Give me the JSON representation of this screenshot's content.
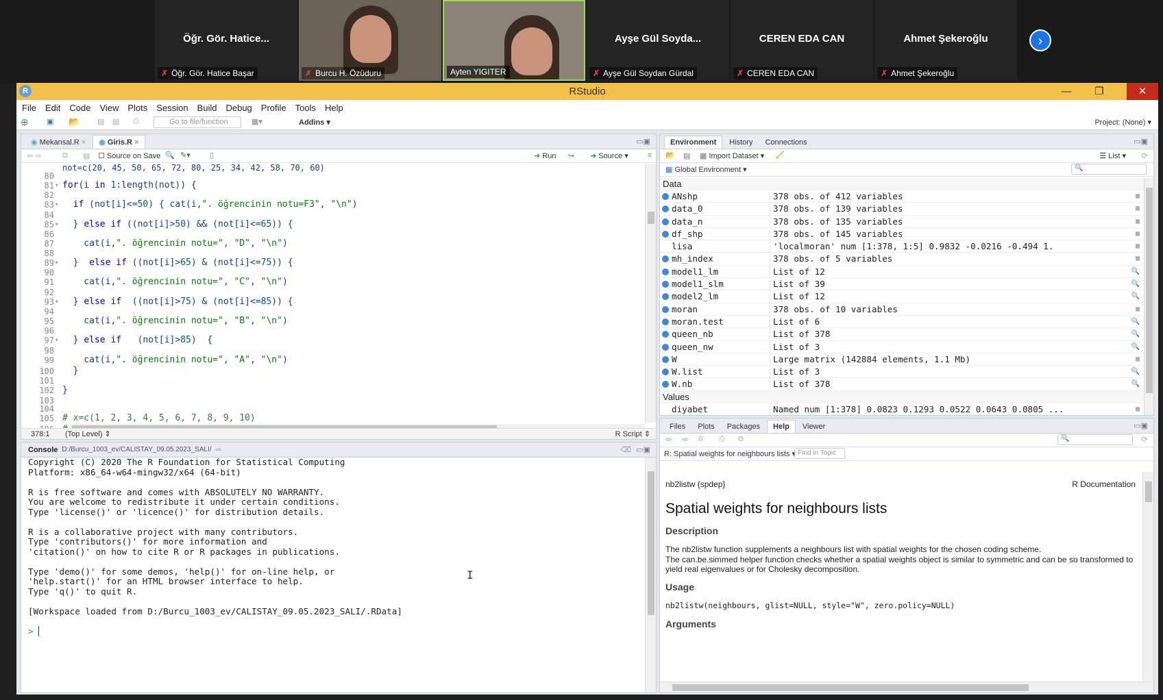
{
  "zoom": {
    "tiles": [
      {
        "big": "Öğr. Gör. Hatice...",
        "name": "Öğr. Gör. Hatice Başar",
        "video": false
      },
      {
        "big": "",
        "name": "Burcu H. Özüduru",
        "video": true
      },
      {
        "big": "",
        "name": "Ayten YIGITER",
        "video": true,
        "active": true
      },
      {
        "big": "Ayşe Gül Soyda...",
        "name": "Ayşe Gül Soydan Gürdal",
        "video": false
      },
      {
        "big": "CEREN EDA CAN",
        "name": "CEREN EDA CAN",
        "video": false
      },
      {
        "big": "Ahmet Şekeroğlu",
        "name": "Ahmet Şekeroğlu",
        "video": false
      }
    ],
    "next_icon": "›"
  },
  "window": {
    "title": "RStudio",
    "logo": "R"
  },
  "menu": [
    "File",
    "Edit",
    "Code",
    "View",
    "Plots",
    "Session",
    "Build",
    "Debug",
    "Profile",
    "Tools",
    "Help"
  ],
  "toolbar": {
    "goto_placeholder": "Go to file/function",
    "addins": "Addins",
    "project": "Project: (None)"
  },
  "editor": {
    "tabs": [
      "Mekansal.R",
      "Giris.R"
    ],
    "source_on_save": "Source on Save",
    "run": "Run",
    "source": "Source",
    "lines": [
      {
        "n": "80",
        "f": "",
        "t": ""
      },
      {
        "n": "81",
        "f": "▾",
        "t": "for(i in 1:length(not)) {"
      },
      {
        "n": "82",
        "f": "",
        "t": ""
      },
      {
        "n": "83",
        "f": "▾",
        "t": "  if (not[i]<=50) { cat(i,\". öğrencinin notu=F3\", \"\\n\")"
      },
      {
        "n": "84",
        "f": "",
        "t": ""
      },
      {
        "n": "85",
        "f": "▾",
        "t": "  } else if ((not[i]>50) && (not[i]<=65)) {"
      },
      {
        "n": "86",
        "f": "",
        "t": ""
      },
      {
        "n": "87",
        "f": "",
        "t": "    cat(i,\". öğrencinin notu=\", \"D\", \"\\n\")"
      },
      {
        "n": "88",
        "f": "",
        "t": ""
      },
      {
        "n": "89",
        "f": "▾",
        "t": "  }  else if ((not[i]>65) & (not[i]<=75)) {"
      },
      {
        "n": "90",
        "f": "",
        "t": ""
      },
      {
        "n": "91",
        "f": "",
        "t": "    cat(i,\". öğrencinin notu=\", \"C\", \"\\n\")"
      },
      {
        "n": "92",
        "f": "",
        "t": ""
      },
      {
        "n": "93",
        "f": "▾",
        "t": "  } else if  ((not[i]>75) & (not[i]<=85)) {"
      },
      {
        "n": "94",
        "f": "",
        "t": ""
      },
      {
        "n": "95",
        "f": "",
        "t": "    cat(i,\". öğrencinin notu=\", \"B\", \"\\n\")"
      },
      {
        "n": "96",
        "f": "",
        "t": ""
      },
      {
        "n": "97",
        "f": "▾",
        "t": "  } else if   (not[i]>85)  {"
      },
      {
        "n": "98",
        "f": "",
        "t": ""
      },
      {
        "n": "99",
        "f": "",
        "t": "    cat(i,\". öğrencinin notu=\", \"A\", \"\\n\")"
      },
      {
        "n": "100",
        "f": "",
        "t": "  }"
      },
      {
        "n": "101",
        "f": "",
        "t": ""
      },
      {
        "n": "102",
        "f": "",
        "t": "}"
      },
      {
        "n": "103",
        "f": "",
        "t": ""
      },
      {
        "n": "104",
        "f": "",
        "t": ""
      },
      {
        "n": "105",
        "f": "",
        "t": "# x=c(1, 2, 3, 4, 5, 6, 7, 8, 9, 10)"
      },
      {
        "n": "106",
        "f": "",
        "t": "#"
      },
      {
        "n": "107",
        "f": "",
        "t": ""
      }
    ],
    "status_pos": "378:1",
    "status_scope": "(Top Level)",
    "status_type": "R Script"
  },
  "console": {
    "label": "Console",
    "path": "D:/Burcu_1003_ev/CALISTAY_09.05.2023_SALI/",
    "lines": [
      "Copyright (C) 2020 The R Foundation for Statistical Computing",
      "Platform: x86_64-w64-mingw32/x64 (64-bit)",
      "",
      "R is free software and comes with ABSOLUTELY NO WARRANTY.",
      "You are welcome to redistribute it under certain conditions.",
      "Type 'license()' or 'licence()' for distribution details.",
      "",
      "R is a collaborative project with many contributors.",
      "Type 'contributors()' for more information and",
      "'citation()' on how to cite R or R packages in publications.",
      "",
      "Type 'demo()' for some demos, 'help()' for on-line help, or",
      "'help.start()' for an HTML browser interface to help.",
      "Type 'q()' to quit R.",
      "",
      "[Workspace loaded from D:/Burcu_1003_ev/CALISTAY_09.05.2023_SALI/.RData]",
      ""
    ],
    "prompt": ">"
  },
  "env": {
    "tabs": [
      "Environment",
      "History",
      "Connections"
    ],
    "import": "Import Dataset",
    "list": "List",
    "scope": "Global Environment",
    "data_header": "Data",
    "values_header": "Values",
    "data": [
      {
        "n": "ANshp",
        "v": "378 obs. of 412 variables"
      },
      {
        "n": "data_0",
        "v": "378 obs. of 139 variables"
      },
      {
        "n": "data_n",
        "v": "378 obs. of 135 variables"
      },
      {
        "n": "df_shp",
        "v": "378 obs. of 145 variables"
      },
      {
        "n": "lisa",
        "v": "'localmoran' num [1:378, 1:5] 0.9832 -0.0216 -0.494 1.",
        "noicon": true
      },
      {
        "n": "mh_index",
        "v": "378 obs. of 5 variables"
      },
      {
        "n": "model1_lm",
        "v": "List of 12"
      },
      {
        "n": "model1_slm",
        "v": "List of 39"
      },
      {
        "n": "model2_lm",
        "v": "List of 12"
      },
      {
        "n": "moran",
        "v": "378 obs. of 10 variables"
      },
      {
        "n": "moran.test",
        "v": "List of 6"
      },
      {
        "n": "queen_nb",
        "v": "List of 378"
      },
      {
        "n": "queen_nw",
        "v": "List of 3"
      },
      {
        "n": "W",
        "v": "Large matrix (142884 elements, 1.1 Mb)"
      },
      {
        "n": "W.list",
        "v": "List of 3"
      },
      {
        "n": "W.nb",
        "v": "List of 378"
      }
    ],
    "values": [
      {
        "n": "diyabet",
        "v": "Named num [1:378] 0.0823 0.1293 0.0522 0.0643 0.0805 ...",
        "noicon": true
      }
    ]
  },
  "help": {
    "tabs": [
      "Files",
      "Plots",
      "Packages",
      "Help",
      "Viewer"
    ],
    "topic": "R: Spatial weights for neighbours lists",
    "find": "Find in Topic",
    "pkg": "nb2listw {spdep}",
    "rdoc": "R Documentation",
    "title": "Spatial weights for neighbours lists",
    "desc_h": "Description",
    "desc1": "The nb2listw function supplements a neighbours list with spatial weights for the chosen coding scheme.",
    "desc2": "The can.be.simmed helper function checks whether a spatial weights object is similar to symmetric and can be so transformed to yield real eigenvalues or for Cholesky decomposition.",
    "usage_h": "Usage",
    "usage": "nb2listw(neighbours, glist=NULL, style=\"W\", zero.policy=NULL)",
    "args_h": "Arguments"
  }
}
